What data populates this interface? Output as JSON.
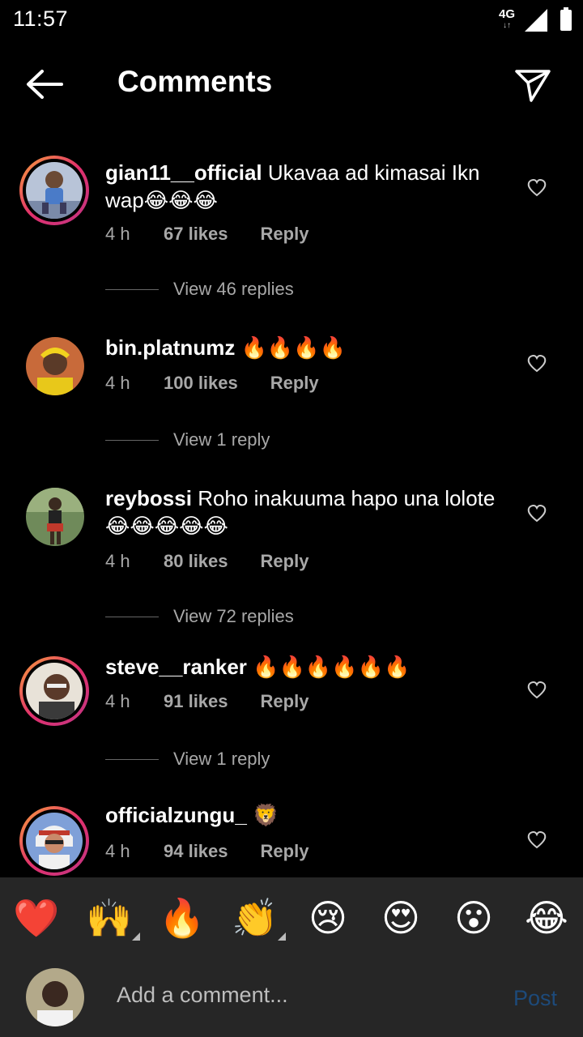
{
  "status_bar": {
    "time": "11:57",
    "network": "4G"
  },
  "header": {
    "title": "Comments"
  },
  "comments": [
    {
      "username": "gian11__official",
      "text": "Ukavaa ad kimasai Ikn wap😂😂😂",
      "time": "4 h",
      "likes": "67 likes",
      "reply": "Reply",
      "view_replies": "View 46 replies"
    },
    {
      "username": "bin.platnumz",
      "text": "🔥🔥🔥🔥",
      "time": "4 h",
      "likes": "100 likes",
      "reply": "Reply",
      "view_replies": "View 1 reply"
    },
    {
      "username": "reybossi",
      "text": "Roho inakuuma hapo una lolote 😂😂😂😂😂",
      "time": "4 h",
      "likes": "80 likes",
      "reply": "Reply",
      "view_replies": "View 72 replies"
    },
    {
      "username": "steve__ranker",
      "text": "🔥🔥🔥🔥🔥🔥",
      "time": "4 h",
      "likes": "91 likes",
      "reply": "Reply",
      "view_replies": "View 1 reply"
    },
    {
      "username": "officialzungu_",
      "text": "🦁",
      "time": "4 h",
      "likes": "94 likes",
      "reply": "Reply"
    }
  ],
  "reactions": [
    "❤️",
    "🙌",
    "🔥",
    "👏",
    "😢",
    "😍",
    "😮",
    "😂"
  ],
  "composer": {
    "placeholder": "Add a comment...",
    "post_label": "Post"
  },
  "colors": {
    "background": "#000000",
    "bar": "#262626",
    "muted": "#a8a8a8",
    "post_disabled": "#1d4a7a"
  }
}
